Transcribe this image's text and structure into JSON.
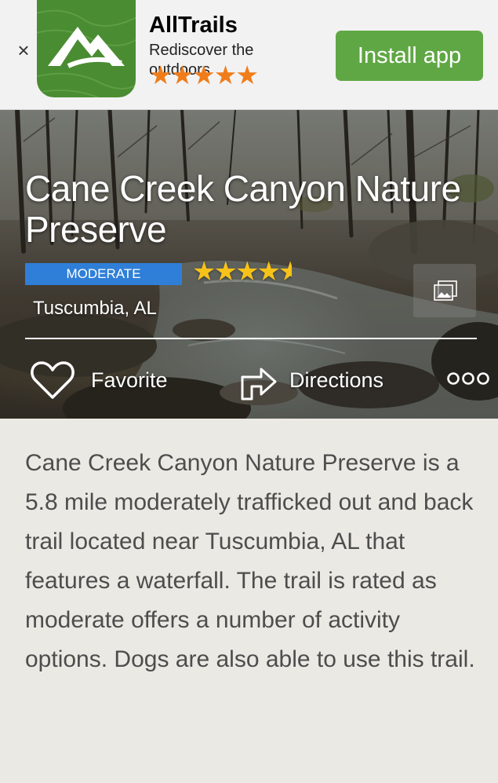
{
  "banner": {
    "close_glyph": "×",
    "app_name": "AllTrails",
    "tagline": "Rediscover the outdoors",
    "stars": "★★★★★",
    "install_label": "Install app",
    "icon": "alltrails-mountain-logo",
    "brand_green": "#5fa744",
    "star_color": "#f07d1a"
  },
  "trail": {
    "name": "Cane Creek Canyon Nature Preserve",
    "difficulty": "MODERATE",
    "difficulty_color": "#2f7fd8",
    "rating_stars": "★★★★",
    "rating_half": "★",
    "rating_value": 4.5,
    "location": "Tuscumbia, AL"
  },
  "actions": {
    "favorite_label": "Favorite",
    "directions_label": "Directions",
    "favorite_icon": "heart-outline-icon",
    "directions_icon": "turn-right-arrow-icon",
    "more_icon": "more-dots-icon",
    "gallery_icon": "photo-gallery-icon"
  },
  "description": "Cane Creek Canyon Nature Preserve is a 5.8 mile moderately trafficked out and back trail located near Tuscumbia, AL that features a waterfall. The trail is rated as moderate offers a number of activity options. Dogs are also able to use this trail."
}
